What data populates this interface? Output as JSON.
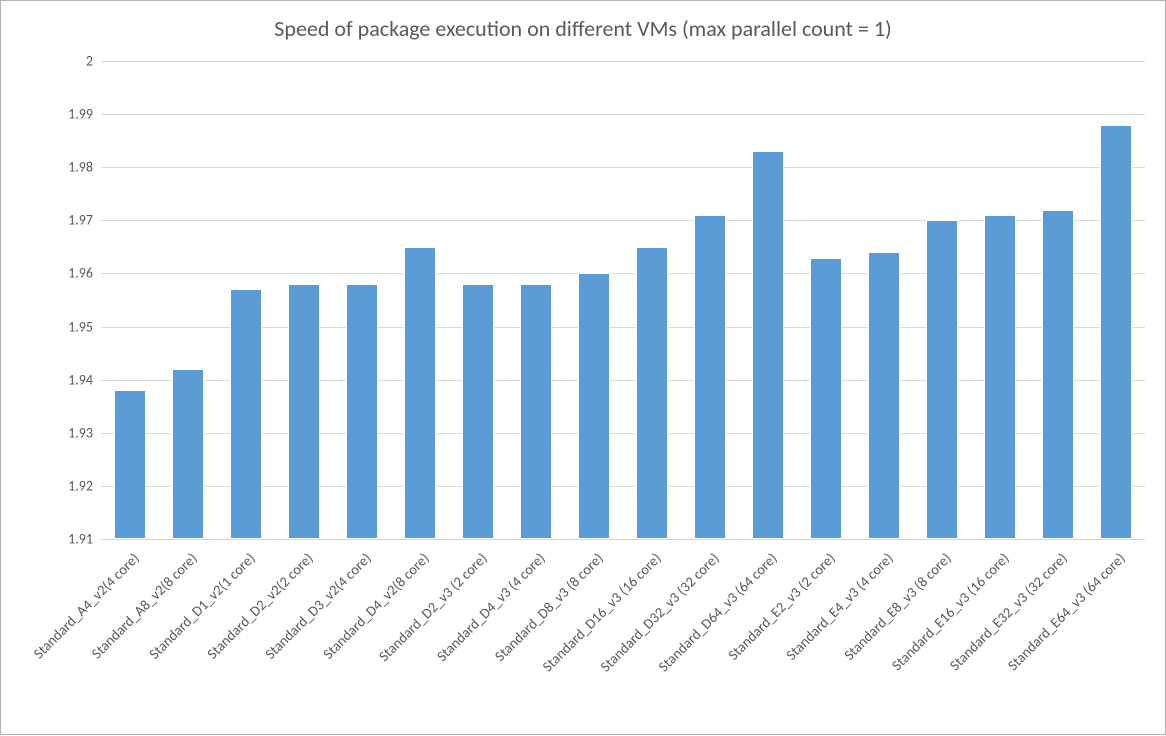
{
  "chart_data": {
    "type": "bar",
    "title": "Speed of package execution on different VMs (max parallel count = 1)",
    "xlabel": "",
    "ylabel": "",
    "ylim": [
      1.91,
      2
    ],
    "yticks": [
      1.91,
      1.92,
      1.93,
      1.94,
      1.95,
      1.96,
      1.97,
      1.98,
      1.99,
      2
    ],
    "categories": [
      "Standard_A4_v2(4 core)",
      "Standard_A8_v2(8 core)",
      "Standard_D1_v2(1 core)",
      "Standard_D2_v2(2 core)",
      "Standard_D3_v2(4 core)",
      "Standard_D4_v2(8 core)",
      "Standard_D2_v3 (2 core)",
      "Standard_D4_v3 (4 core)",
      "Standard_D8_v3 (8 core)",
      "Standard_D16_v3 (16 core)",
      "Standard_D32_v3 (32 core)",
      "Standard_D64_v3 (64 core)",
      "Standard_E2_v3 (2 core)",
      "Standard_E4_v3 (4 core)",
      "Standard_E8_v3 (8 core)",
      "Standard_E16_v3 (16 core)",
      "Standard_E32_v3 (32 core)",
      "Standard_E64_v3 (64 core)"
    ],
    "values": [
      1.938,
      1.942,
      1.957,
      1.958,
      1.958,
      1.965,
      1.958,
      1.958,
      1.96,
      1.965,
      1.971,
      1.983,
      1.963,
      1.964,
      1.97,
      1.971,
      1.972,
      1.988
    ],
    "bar_color": "#5b9bd5",
    "grid_color": "#d9d9d9"
  }
}
